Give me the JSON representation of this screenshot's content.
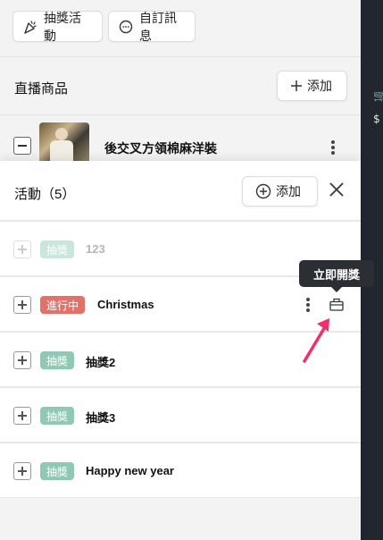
{
  "toolbar": {
    "lottery_label": "抽獎活動",
    "custom_message_label": "自訂訊息"
  },
  "products": {
    "title": "直播商品",
    "add_label": "添加",
    "items": [
      {
        "name": "後交叉方領棉麻洋裝"
      }
    ]
  },
  "activities": {
    "title": "活動（5）",
    "add_label": "添加",
    "items": [
      {
        "status": "抽獎",
        "name": "123"
      },
      {
        "status": "進行中",
        "name": "Christmas"
      },
      {
        "status": "抽獎",
        "name": "抽獎2"
      },
      {
        "status": "抽獎",
        "name": "抽獎3"
      },
      {
        "status": "抽獎",
        "name": "Happy new year"
      }
    ]
  },
  "tooltip": {
    "draw_now": "立即開獎"
  },
  "colors": {
    "draw_badge": "#8ec9b4",
    "ongoing_badge": "#e2716a",
    "annotation_arrow": "#f0306a",
    "side_rail": "#22262e"
  },
  "icons": [
    "party-popper-icon",
    "chat-bubble-icon",
    "plus-icon",
    "plus-circle-icon",
    "close-icon",
    "kebab-menu-icon",
    "gift-box-icon",
    "cart-icon",
    "dollar-icon"
  ]
}
